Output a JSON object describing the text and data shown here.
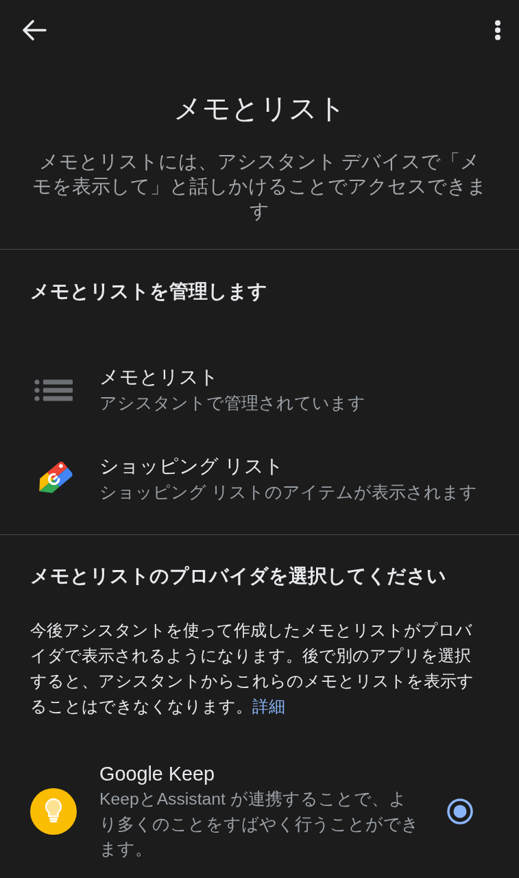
{
  "title": "メモとリスト",
  "description": "メモとリストには、アシスタント デバイスで「メモを表示して」と話しかけることでアクセスできます",
  "manage_section": {
    "heading": "メモとリストを管理します",
    "items": [
      {
        "kind": "notes",
        "title": "メモとリスト",
        "subtitle": "アシスタントで管理されています"
      },
      {
        "kind": "shopping",
        "title": "ショッピング リスト",
        "subtitle": "ショッピング リストのアイテムが表示されます"
      }
    ]
  },
  "provider_section": {
    "heading": "メモとリストのプロバイダを選択してください",
    "info": "今後アシスタントを使って作成したメモとリストがプロバイダで表示されるようになります。後で別のアプリを選択すると、アシスタントからこれらのメモとリストを表示することはできなくなります。",
    "link": "詳細",
    "providers": [
      {
        "kind": "keep",
        "name": "Google Keep",
        "description": "KeepとAssistant が連携することで、より多くのことをすばやく行うことができます。",
        "selected": true
      }
    ]
  }
}
